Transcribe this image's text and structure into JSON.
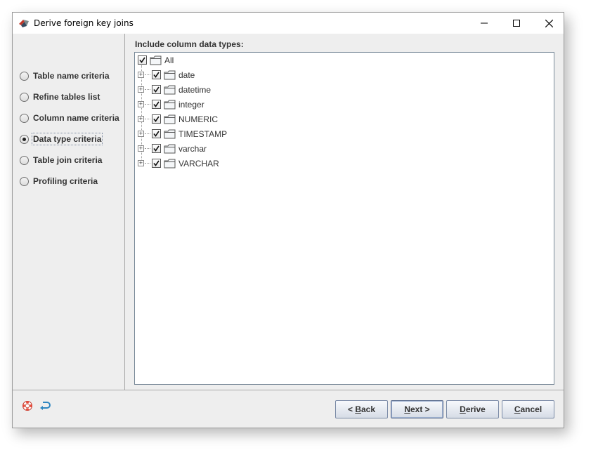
{
  "window": {
    "title": "Derive foreign key joins"
  },
  "steps": [
    {
      "label": "Table name criteria",
      "selected": false
    },
    {
      "label": "Refine tables list",
      "selected": false
    },
    {
      "label": "Column name criteria",
      "selected": false
    },
    {
      "label": "Data type criteria",
      "selected": true
    },
    {
      "label": "Table join criteria",
      "selected": false
    },
    {
      "label": "Profiling criteria",
      "selected": false
    }
  ],
  "content": {
    "heading": "Include column data types:",
    "tree": {
      "root": {
        "label": "All",
        "checked": true
      },
      "children": [
        {
          "label": "date",
          "checked": true,
          "expandable": true
        },
        {
          "label": "datetime",
          "checked": true,
          "expandable": true
        },
        {
          "label": "integer",
          "checked": true,
          "expandable": true
        },
        {
          "label": "NUMERIC",
          "checked": true,
          "expandable": true
        },
        {
          "label": "TIMESTAMP",
          "checked": true,
          "expandable": true
        },
        {
          "label": "varchar",
          "checked": true,
          "expandable": true
        },
        {
          "label": "VARCHAR",
          "checked": true,
          "expandable": true
        }
      ]
    }
  },
  "footer": {
    "icons": [
      "lifebuoy-help-icon",
      "undo-arrow-icon"
    ],
    "buttons": {
      "back": "< Back",
      "next": "Next >",
      "derive": "Derive",
      "cancel": "Cancel"
    },
    "mnemonics": {
      "back": "B",
      "next": "N",
      "derive": "D",
      "cancel": "C"
    }
  },
  "colors": {
    "window_bg": "#eeeeee",
    "tree_border": "#7a8a99",
    "button_border": "#7a8aa6"
  }
}
